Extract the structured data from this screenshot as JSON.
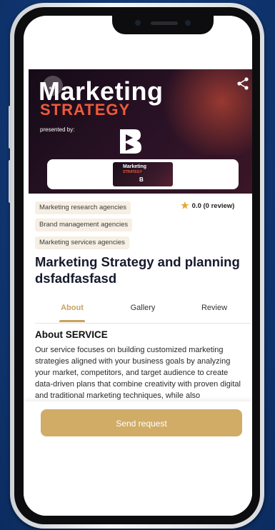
{
  "banner": {
    "title_line1": "Marketing",
    "title_line2": "STRATEGY",
    "presented_by": "presented by:",
    "thumb_line1": "Marketing",
    "thumb_line2": "STRATEGY",
    "accent_color": "#ef5a3b"
  },
  "tags": [
    "Marketing research agencies",
    "Brand management agencies",
    "Marketing services agencies"
  ],
  "rating": {
    "text": "0.0 (0 review)",
    "icon": "star-icon",
    "star_color": "#e5a733"
  },
  "service": {
    "title": "Marketing Strategy and planning dsfadfasfasd"
  },
  "tabs": {
    "about": "About",
    "gallery": "Gallery",
    "review": "Review",
    "active_color": "#c9a25d"
  },
  "about": {
    "heading": "About SERVICE",
    "body": "Our service focuses on building customized marketing strategies aligned with your business goals by analyzing your market, competitors, and target audience to create data-driven plans that combine creativity with proven digital and traditional marketing techniques, while also"
  },
  "cta": {
    "label": "Send request",
    "color": "#d0ac67"
  },
  "icons": {
    "back": "back-arrow-icon",
    "share": "share-icon"
  }
}
